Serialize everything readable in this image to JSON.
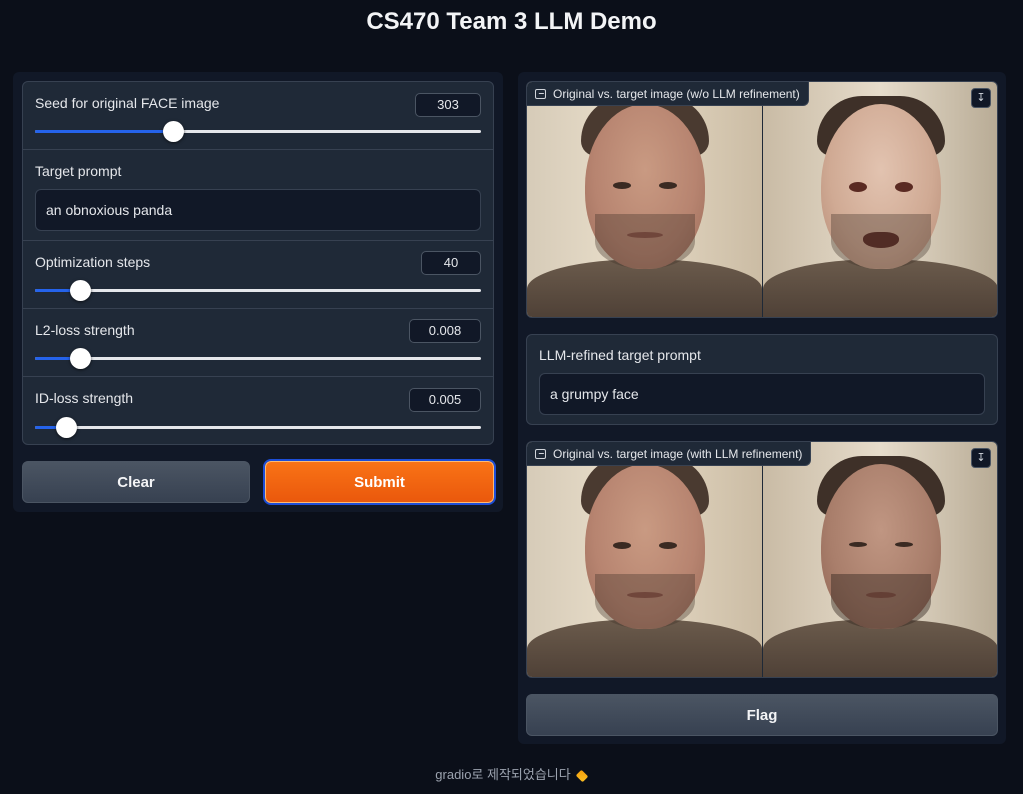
{
  "app": {
    "title": "CS470 Team 3 LLM Demo"
  },
  "controls": {
    "seed": {
      "label": "Seed for original FACE image",
      "value": "303",
      "fraction": 0.31
    },
    "target_prompt": {
      "label": "Target prompt",
      "value": "an obnoxious panda"
    },
    "steps": {
      "label": "Optimization steps",
      "value": "40",
      "fraction": 0.1
    },
    "l2": {
      "label": "L2-loss strength",
      "value": "0.008",
      "fraction": 0.1
    },
    "id": {
      "label": "ID-loss strength",
      "value": "0.005",
      "fraction": 0.07
    }
  },
  "buttons": {
    "clear": "Clear",
    "submit": "Submit",
    "flag": "Flag"
  },
  "outputs": {
    "image1": {
      "label": "Original vs. target image (w/o LLM refinement)"
    },
    "refined": {
      "label": "LLM-refined target prompt",
      "value": "a grumpy face"
    },
    "image2": {
      "label": "Original vs. target image (with LLM refinement)"
    }
  },
  "icons": {
    "image": "image-icon",
    "download": "download-icon",
    "logo": "gradio-logo-icon"
  },
  "colors": {
    "accent": "#2563eb",
    "submit": "#f97316",
    "background": "#0b0f19"
  },
  "footer": {
    "text": "gradio로 제작되었습니다"
  }
}
